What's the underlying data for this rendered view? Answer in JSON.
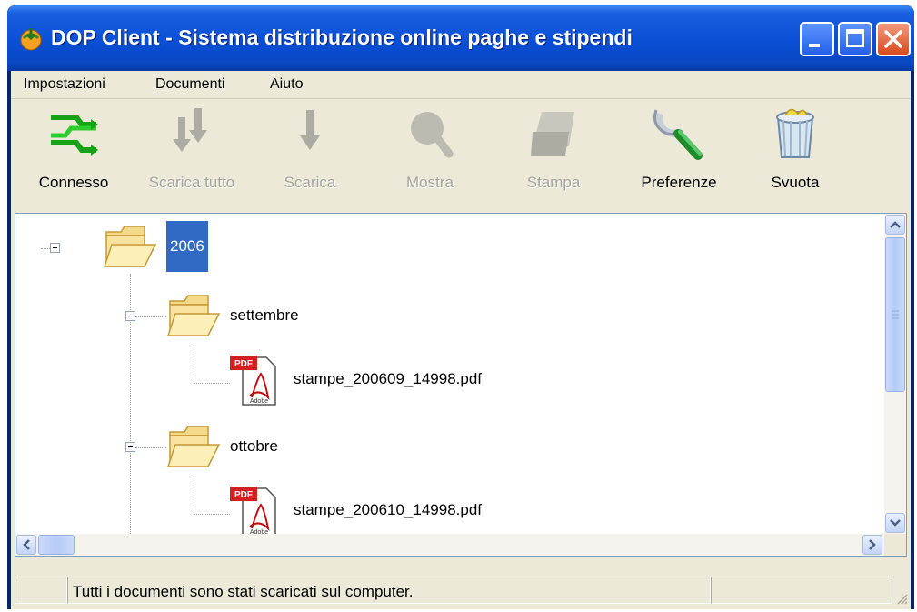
{
  "window": {
    "title": "DOP Client - Sistema distribuzione online paghe e stipendi"
  },
  "menu": [
    "Impostazioni",
    "Documenti",
    "Aiuto"
  ],
  "toolbar": [
    {
      "label": "Connesso",
      "icon": "connected-icon",
      "enabled": true
    },
    {
      "label": "Scarica tutto",
      "icon": "download-all-icon",
      "enabled": false
    },
    {
      "label": "Scarica",
      "icon": "download-icon",
      "enabled": false
    },
    {
      "label": "Mostra",
      "icon": "magnifier-icon",
      "enabled": false
    },
    {
      "label": "Stampa",
      "icon": "printer-icon",
      "enabled": false
    },
    {
      "label": "Preferenze",
      "icon": "wrench-icon",
      "enabled": true
    },
    {
      "label": "Svuota",
      "icon": "recycle-bin-icon",
      "enabled": true
    }
  ],
  "tree": {
    "root": {
      "label": "2006",
      "selected": true
    },
    "months": [
      {
        "label": "settembre",
        "file": "stampe_200609_14998.pdf"
      },
      {
        "label": "ottobre",
        "file": "stampe_200610_14998.pdf"
      }
    ]
  },
  "status": {
    "text": "Tutti i documenti sono stati scaricati sul computer."
  },
  "colors": {
    "titlebar": "#0a4fd6",
    "selection": "#316ac5",
    "chrome": "#ece9d8",
    "close": "#d84a1e"
  }
}
